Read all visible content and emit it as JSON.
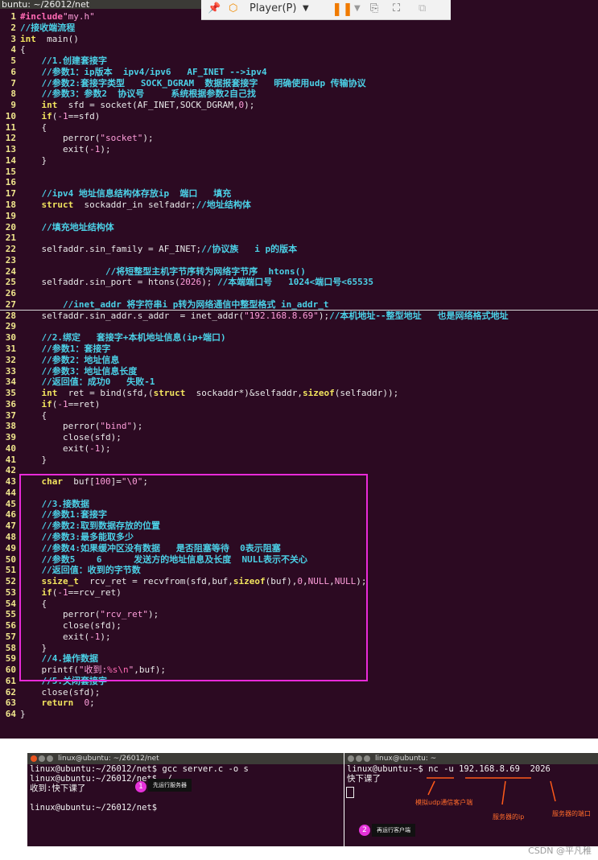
{
  "window_title": "buntu: ~/26012/net",
  "toolbar": {
    "player_label": "Player(P)"
  },
  "code_lines": [
    {
      "n": "1",
      "segs": [
        [
          "pp",
          "#include"
        ],
        [
          "st",
          "\"my.h\""
        ]
      ]
    },
    {
      "n": "2",
      "segs": [
        [
          "cm",
          "//接收端流程"
        ]
      ]
    },
    {
      "n": "3",
      "segs": [
        [
          "kw",
          "int"
        ],
        [
          "",
          "  main()"
        ]
      ]
    },
    {
      "n": "4",
      "segs": [
        [
          "",
          "{"
        ]
      ]
    },
    {
      "n": "5",
      "segs": [
        [
          "",
          "    "
        ],
        [
          "cm",
          "//1.创建套接字"
        ]
      ]
    },
    {
      "n": "6",
      "segs": [
        [
          "",
          "    "
        ],
        [
          "cm",
          "//参数1：ip版本  ipv4/ipv6   AF_INET -->ipv4"
        ]
      ]
    },
    {
      "n": "7",
      "segs": [
        [
          "",
          "    "
        ],
        [
          "cm",
          "//参数2:套接字类型   SOCK_DGRAM  数据报套接字   明确使用udp 传输协议"
        ]
      ]
    },
    {
      "n": "8",
      "segs": [
        [
          "",
          "    "
        ],
        [
          "cm",
          "//参数3：参数2  协议号     系统根据参数2自己找"
        ]
      ]
    },
    {
      "n": "9",
      "segs": [
        [
          "",
          "    "
        ],
        [
          "kw",
          "int"
        ],
        [
          "",
          "  sfd = socket(AF_INET,SOCK_DGRAM,"
        ],
        [
          "st",
          "0"
        ],
        [
          "",
          ");"
        ]
      ]
    },
    {
      "n": "10",
      "segs": [
        [
          "",
          "    "
        ],
        [
          "kw",
          "if"
        ],
        [
          "",
          "("
        ],
        [
          "st",
          "-1"
        ],
        [
          "",
          "==sfd)"
        ]
      ]
    },
    {
      "n": "11",
      "segs": [
        [
          "",
          "    {"
        ]
      ]
    },
    {
      "n": "12",
      "segs": [
        [
          "",
          "        perror("
        ],
        [
          "st",
          "\"socket\""
        ],
        [
          "",
          ");"
        ]
      ]
    },
    {
      "n": "13",
      "segs": [
        [
          "",
          "        exit("
        ],
        [
          "st",
          "-1"
        ],
        [
          "",
          ");"
        ]
      ]
    },
    {
      "n": "14",
      "segs": [
        [
          "",
          "    }"
        ]
      ]
    },
    {
      "n": "15",
      "segs": [
        [
          "",
          ""
        ]
      ]
    },
    {
      "n": "16",
      "segs": [
        [
          "",
          ""
        ]
      ]
    },
    {
      "n": "17",
      "segs": [
        [
          "",
          "    "
        ],
        [
          "cm",
          "//ipv4 地址信息结构体存放ip  端口   填充"
        ]
      ]
    },
    {
      "n": "18",
      "segs": [
        [
          "",
          "    "
        ],
        [
          "kw",
          "struct"
        ],
        [
          "",
          "  sockaddr_in selfaddr;"
        ],
        [
          "cm",
          "//地址结构体"
        ]
      ]
    },
    {
      "n": "19",
      "segs": [
        [
          "",
          ""
        ]
      ]
    },
    {
      "n": "20",
      "segs": [
        [
          "",
          "    "
        ],
        [
          "cm",
          "//填充地址结构体"
        ]
      ]
    },
    {
      "n": "21",
      "segs": [
        [
          "",
          ""
        ]
      ]
    },
    {
      "n": "22",
      "segs": [
        [
          "",
          "    selfaddr.sin_family = AF_INET;"
        ],
        [
          "cm",
          "//协议族   i p的版本"
        ]
      ]
    },
    {
      "n": "23",
      "segs": [
        [
          "",
          ""
        ]
      ]
    },
    {
      "n": "24",
      "segs": [
        [
          "",
          "                "
        ],
        [
          "cm",
          "//将短整型主机字节序转为网络字节序  htons()"
        ]
      ]
    },
    {
      "n": "25",
      "segs": [
        [
          "",
          "    selfaddr.sin_port = htons("
        ],
        [
          "st",
          "2026"
        ],
        [
          "",
          "); "
        ],
        [
          "cm",
          "//本端端口号   1024<端口号<65535"
        ]
      ]
    },
    {
      "n": "26",
      "segs": [
        [
          "",
          ""
        ]
      ]
    },
    {
      "n": "27",
      "segs": [
        [
          "",
          "        "
        ],
        [
          "cm",
          "//inet_addr 将字符串i p转为网络通信中整型格式 in_addr_t"
        ]
      ]
    },
    {
      "n": "28",
      "segs": [
        [
          "",
          "    selfaddr.sin_addr.s_addr  = inet_addr("
        ],
        [
          "st",
          "\"192.168.8.69\""
        ],
        [
          "",
          ");"
        ],
        [
          "cm",
          "//本机地址--整型地址   也是网络格式地址"
        ]
      ]
    },
    {
      "n": "29",
      "segs": [
        [
          "",
          ""
        ]
      ]
    },
    {
      "n": "30",
      "segs": [
        [
          "",
          "    "
        ],
        [
          "cm",
          "//2.绑定   套接字+本机地址信息(ip+端口)"
        ]
      ]
    },
    {
      "n": "31",
      "segs": [
        [
          "",
          "    "
        ],
        [
          "cm",
          "//参数1：套接字"
        ]
      ]
    },
    {
      "n": "32",
      "segs": [
        [
          "",
          "    "
        ],
        [
          "cm",
          "//参数2：地址信息"
        ]
      ]
    },
    {
      "n": "33",
      "segs": [
        [
          "",
          "    "
        ],
        [
          "cm",
          "//参数3：地址信息长度"
        ]
      ]
    },
    {
      "n": "34",
      "segs": [
        [
          "",
          "    "
        ],
        [
          "cm",
          "//返回值：成功0   失败-1"
        ]
      ]
    },
    {
      "n": "35",
      "segs": [
        [
          "",
          "    "
        ],
        [
          "kw",
          "int"
        ],
        [
          "",
          "  ret = bind(sfd,("
        ],
        [
          "kw",
          "struct"
        ],
        [
          "",
          "  sockaddr*)&selfaddr,"
        ],
        [
          "kw",
          "sizeof"
        ],
        [
          "",
          "(selfaddr));"
        ]
      ]
    },
    {
      "n": "36",
      "segs": [
        [
          "",
          "    "
        ],
        [
          "kw",
          "if"
        ],
        [
          "",
          "("
        ],
        [
          "st",
          "-1"
        ],
        [
          "",
          "==ret)"
        ]
      ]
    },
    {
      "n": "37",
      "segs": [
        [
          "",
          "    {"
        ]
      ]
    },
    {
      "n": "38",
      "segs": [
        [
          "",
          "        perror("
        ],
        [
          "st",
          "\"bind\""
        ],
        [
          "",
          ");"
        ]
      ]
    },
    {
      "n": "39",
      "segs": [
        [
          "",
          "        close(sfd);"
        ]
      ]
    },
    {
      "n": "40",
      "segs": [
        [
          "",
          "        exit("
        ],
        [
          "st",
          "-1"
        ],
        [
          "",
          ");"
        ]
      ]
    },
    {
      "n": "41",
      "segs": [
        [
          "",
          "    }"
        ]
      ]
    },
    {
      "n": "42",
      "segs": [
        [
          "",
          ""
        ]
      ]
    },
    {
      "n": "43",
      "segs": [
        [
          "",
          "    "
        ],
        [
          "kw",
          "char"
        ],
        [
          "",
          "  buf["
        ],
        [
          "st",
          "100"
        ],
        [
          "",
          "]="
        ],
        [
          "st",
          "\"\\0\""
        ],
        [
          "",
          ";"
        ]
      ]
    },
    {
      "n": "44",
      "segs": [
        [
          "",
          ""
        ]
      ]
    },
    {
      "n": "45",
      "segs": [
        [
          "",
          "    "
        ],
        [
          "cm",
          "//3.接数据"
        ]
      ]
    },
    {
      "n": "46",
      "segs": [
        [
          "",
          "    "
        ],
        [
          "cm",
          "//参数1:套接字"
        ]
      ]
    },
    {
      "n": "47",
      "segs": [
        [
          "",
          "    "
        ],
        [
          "cm",
          "//参数2:取到数据存放的位置"
        ]
      ]
    },
    {
      "n": "48",
      "segs": [
        [
          "",
          "    "
        ],
        [
          "cm",
          "//参数3:最多能取多少"
        ]
      ]
    },
    {
      "n": "49",
      "segs": [
        [
          "",
          "    "
        ],
        [
          "cm",
          "//参数4:如果缓冲区没有数据   是否阻塞等待  0表示阻塞"
        ]
      ]
    },
    {
      "n": "50",
      "segs": [
        [
          "",
          "    "
        ],
        [
          "cm",
          "//参数5    6      发送方的地址信息及长度  NULL表示不关心"
        ]
      ]
    },
    {
      "n": "51",
      "segs": [
        [
          "",
          "    "
        ],
        [
          "cm",
          "//返回值：收到的字节数"
        ]
      ]
    },
    {
      "n": "52",
      "segs": [
        [
          "",
          "    "
        ],
        [
          "kw",
          "ssize_t"
        ],
        [
          "",
          "  rcv_ret = recvfrom(sfd,buf,"
        ],
        [
          "kw",
          "sizeof"
        ],
        [
          "",
          "(buf),"
        ],
        [
          "st",
          "0"
        ],
        [
          "",
          ","
        ],
        [
          "st",
          "NULL"
        ],
        [
          "",
          ","
        ],
        [
          "st",
          "NULL"
        ],
        [
          "",
          ");"
        ]
      ]
    },
    {
      "n": "53",
      "segs": [
        [
          "",
          "    "
        ],
        [
          "kw",
          "if"
        ],
        [
          "",
          "("
        ],
        [
          "st",
          "-1"
        ],
        [
          "",
          "==rcv_ret)"
        ]
      ]
    },
    {
      "n": "54",
      "segs": [
        [
          "",
          "    {"
        ]
      ]
    },
    {
      "n": "55",
      "segs": [
        [
          "",
          "        perror("
        ],
        [
          "st",
          "\"rcv_ret\""
        ],
        [
          "",
          ");"
        ]
      ]
    },
    {
      "n": "56",
      "segs": [
        [
          "",
          "        close(sfd);"
        ]
      ]
    },
    {
      "n": "57",
      "segs": [
        [
          "",
          "        exit("
        ],
        [
          "st",
          "-1"
        ],
        [
          "",
          ");"
        ]
      ]
    },
    {
      "n": "58",
      "segs": [
        [
          "",
          "    }"
        ]
      ]
    },
    {
      "n": "59",
      "segs": [
        [
          "",
          "    "
        ],
        [
          "cm",
          "//4.操作数据"
        ]
      ]
    },
    {
      "n": "60",
      "segs": [
        [
          "",
          "    printf("
        ],
        [
          "st",
          "\"收到:"
        ],
        [
          "hl",
          "%s\\n"
        ],
        [
          "st",
          "\""
        ],
        [
          "",
          ",buf);"
        ]
      ]
    },
    {
      "n": "61",
      "segs": [
        [
          "",
          "    "
        ],
        [
          "cm",
          "//5.关闭套接字"
        ]
      ]
    },
    {
      "n": "62",
      "segs": [
        [
          "",
          "    close(sfd);"
        ]
      ]
    },
    {
      "n": "63",
      "segs": [
        [
          "",
          "    "
        ],
        [
          "kw",
          "return"
        ],
        [
          "",
          "  "
        ],
        [
          "st",
          "0"
        ],
        [
          "",
          ";"
        ]
      ]
    },
    {
      "n": "64",
      "segs": [
        [
          "",
          "}"
        ]
      ]
    }
  ],
  "terminal_left": {
    "title": "linux@ubuntu: ~/26012/net",
    "lines": [
      "linux@ubuntu:~/26012/net$ gcc server.c -o s",
      "linux@ubuntu:~/26012/net$ ./",
      "收到:快下课了",
      "",
      "linux@ubuntu:~/26012/net$"
    ],
    "badge": "1",
    "note": "先运行服务器"
  },
  "terminal_right": {
    "title": "linux@ubuntu: ~",
    "lines": [
      "linux@ubuntu:~$ nc -u 192.168.8.69  2026",
      "快下课了"
    ],
    "badge": "2",
    "note": "再运行客户端",
    "annotations": [
      "模拟udp通信客户端",
      "服务器的ip",
      "服务器的端口"
    ]
  },
  "watermark": "CSDN @平凡稚"
}
